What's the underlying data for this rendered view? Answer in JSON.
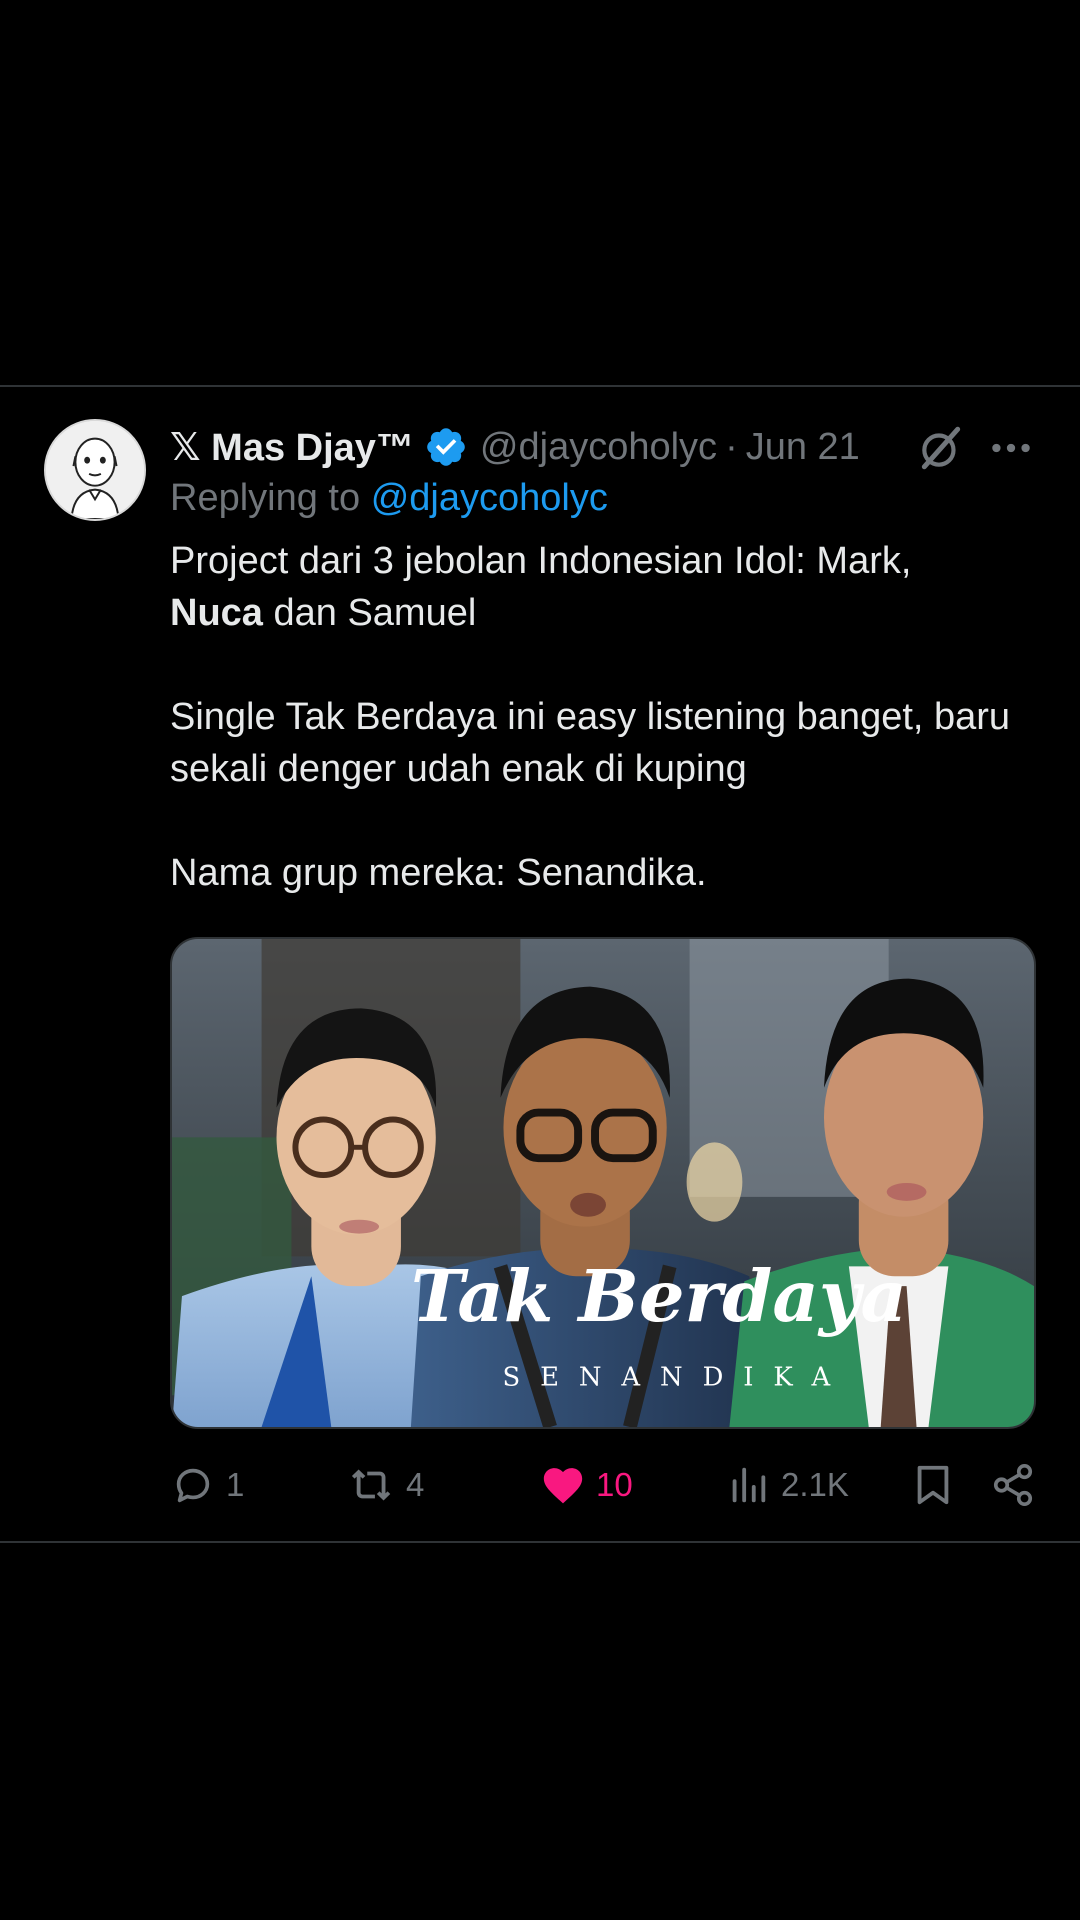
{
  "tweet": {
    "display_name": "𝕏 Mas Djay™",
    "handle": "@djaycoholyc",
    "separator": "·",
    "date": "Jun 21",
    "replying_prefix": "Replying to",
    "replying_to": "@djaycoholyc",
    "body": {
      "line1": "Project dari 3 jebolan Indonesian Idol: Mark,",
      "line2_bold": "Nuca",
      "line2_rest": " dan Samuel",
      "line3": "Single Tak Berdaya ini easy listening banget, baru sekali denger udah enak di kuping",
      "line4": "Nama grup mereka: Senandika."
    },
    "media": {
      "title": "Tak Berdaya",
      "subtitle": "SENANDIKA"
    },
    "actions": {
      "replies": "1",
      "retweets": "4",
      "likes": "10",
      "views": "2.1K"
    }
  },
  "colors": {
    "background": "#000000",
    "text": "#e7e9ea",
    "muted": "#71767b",
    "link": "#1d9bf0",
    "like": "#f91880",
    "verified": "#1d9bf0",
    "divider": "#2f3336"
  },
  "icons": [
    "grok-icon",
    "more-icon",
    "verified-icon",
    "reply-icon",
    "retweet-icon",
    "heart-icon",
    "views-icon",
    "bookmark-icon",
    "share-icon"
  ]
}
